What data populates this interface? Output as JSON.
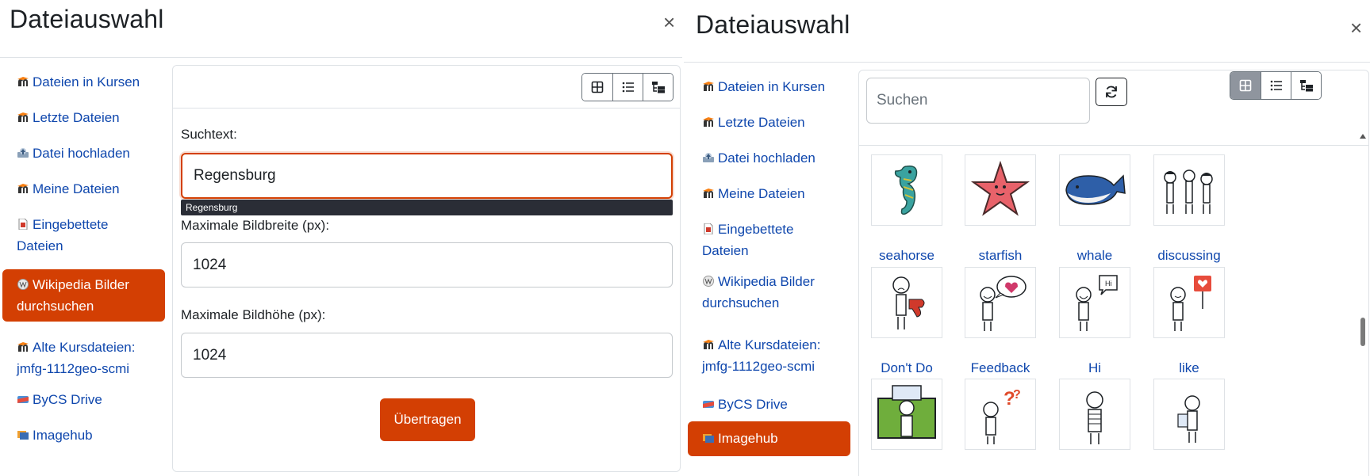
{
  "left_dialog": {
    "title": "Dateiauswahl",
    "close": "×",
    "repositories": [
      {
        "label": "Dateien in Kursen",
        "icon": "moodle-icon"
      },
      {
        "label": "Letzte Dateien",
        "icon": "moodle-icon"
      },
      {
        "label": "Datei hochladen",
        "icon": "upload-icon"
      },
      {
        "label": "Meine Dateien",
        "icon": "moodle-icon"
      },
      {
        "label": "Eingebettete Dateien",
        "icon": "embedded-file-icon"
      },
      {
        "label": "Wikipedia Bilder durchsuchen",
        "icon": "wikipedia-icon"
      },
      {
        "label": "Alte Kursdateien: jmfg-1112geo-scmi",
        "icon": "moodle-icon"
      },
      {
        "label": "ByCS Drive",
        "icon": "drive-icon"
      },
      {
        "label": "Imagehub",
        "icon": "imagehub-icon"
      }
    ],
    "active_repository": "Wikipedia Bilder durchsuchen",
    "form": {
      "search_label": "Suchtext:",
      "search_value": "Regensburg",
      "autocomplete_suggestion": "Regensburg",
      "max_width_label": "Maximale Bildbreite (px):",
      "max_width_value": "1024",
      "max_height_label": "Maximale Bildhöhe (px):",
      "max_height_value": "1024",
      "submit_label": "Übertragen"
    }
  },
  "right_dialog": {
    "title": "Dateiauswahl",
    "close": "×",
    "repositories": [
      {
        "label": "Dateien in Kursen",
        "icon": "moodle-icon"
      },
      {
        "label": "Letzte Dateien",
        "icon": "moodle-icon"
      },
      {
        "label": "Datei hochladen",
        "icon": "upload-icon"
      },
      {
        "label": "Meine Dateien",
        "icon": "moodle-icon"
      },
      {
        "label": "Eingebettete Dateien",
        "icon": "embedded-file-icon"
      },
      {
        "label": "Wikipedia Bilder durchsuchen",
        "icon": "wikipedia-icon"
      },
      {
        "label": "Alte Kursdateien: jmfg-1112geo-scmi",
        "icon": "moodle-icon"
      },
      {
        "label": "ByCS Drive",
        "icon": "drive-icon"
      },
      {
        "label": "Imagehub",
        "icon": "imagehub-icon"
      }
    ],
    "active_repository": "Imagehub",
    "search_placeholder": "Suchen",
    "active_view": "icons",
    "files": [
      {
        "name": "seahorse"
      },
      {
        "name": "starfish"
      },
      {
        "name": "whale"
      },
      {
        "name": "discussing"
      },
      {
        "name": "Don't Do"
      },
      {
        "name": "Feedback"
      },
      {
        "name": "Hi"
      },
      {
        "name": "like"
      },
      {
        "name": ""
      },
      {
        "name": ""
      },
      {
        "name": ""
      },
      {
        "name": ""
      }
    ]
  },
  "colors": {
    "accent": "#d33f03",
    "link": "#0f47ad",
    "border": "#dee2e6"
  }
}
